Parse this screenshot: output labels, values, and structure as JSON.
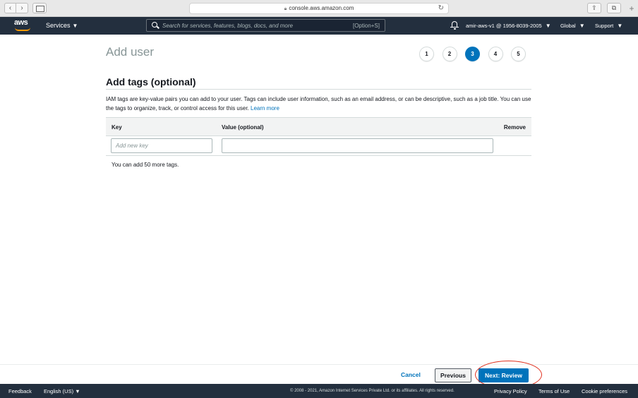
{
  "browser": {
    "url": "console.aws.amazon.com",
    "back_icon": "chevron-left-icon",
    "forward_icon": "chevron-right-icon"
  },
  "nav": {
    "logo": "aws",
    "services_label": "Services",
    "search_placeholder": "Search for services, features, blogs, docs, and more",
    "search_shortcut": "[Option+S]",
    "account": "amir-aws-v1 @ 1956-8039-2005",
    "region": "Global",
    "support": "Support",
    "caret": "▼"
  },
  "page": {
    "title": "Add user",
    "steps": [
      "1",
      "2",
      "3",
      "4",
      "5"
    ],
    "active_step": "3"
  },
  "tags": {
    "heading": "Add tags (optional)",
    "description": "IAM tags are key-value pairs you can add to your user. Tags can include user information, such as an email address, or can be descriptive, such as a job title. You can use the tags to organize, track, or control access for this user.",
    "learn_more": "Learn more",
    "columns": {
      "key": "Key",
      "value": "Value (optional)",
      "remove": "Remove"
    },
    "key_placeholder": "Add new key",
    "remaining": "You can add 50 more tags."
  },
  "actions": {
    "cancel": "Cancel",
    "previous": "Previous",
    "next": "Next: Review"
  },
  "footer": {
    "feedback": "Feedback",
    "language": "English (US)",
    "copyright": "© 2008 - 2021, Amazon Internet Services Private Ltd. or its affiliates. All rights reserved.",
    "privacy": "Privacy Policy",
    "terms": "Terms of Use",
    "cookies": "Cookie preferences"
  },
  "colors": {
    "nav_bg": "#232f3e",
    "accent": "#0073bb",
    "aws_orange": "#ff9900",
    "annotation_red": "#e0301e"
  }
}
